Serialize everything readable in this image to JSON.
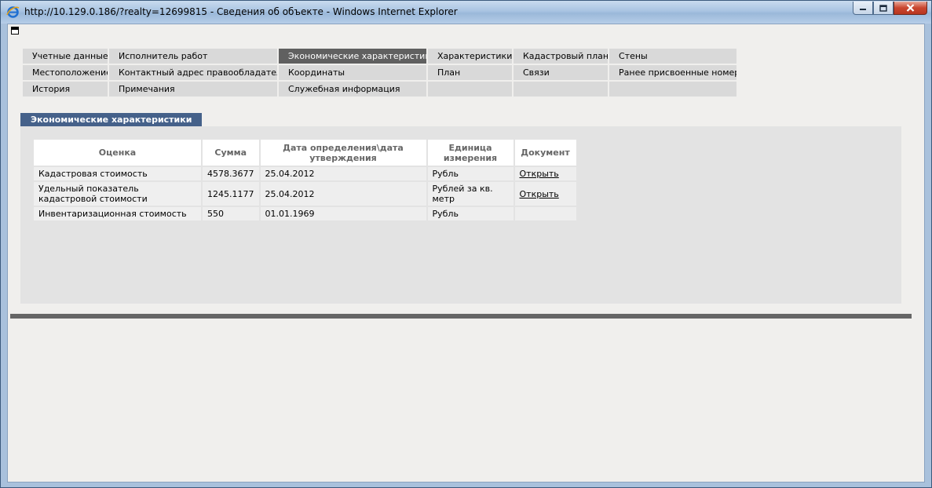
{
  "window": {
    "title": "http://10.129.0.186/?realty=12699815 - Сведения об объекте - Windows Internet Explorer",
    "icon": "ie-icon",
    "controls": [
      "minimize-icon",
      "maximize-icon",
      "close-icon"
    ]
  },
  "nav": {
    "rows": [
      [
        "Учетные данные",
        "Исполнитель работ",
        "Экономические характеристики",
        "Характеристики",
        "Кадастровый план",
        "Стены"
      ],
      [
        "Местоположение",
        "Контактный адрес правообладателя",
        "Координаты",
        "План",
        "Связи",
        "Ранее присвоенные номера"
      ],
      [
        "История",
        "Примечания",
        "Служебная информация",
        "",
        "",
        ""
      ]
    ],
    "active": "Экономические характеристики"
  },
  "section": {
    "title": "Экономические характеристики"
  },
  "table": {
    "headers": [
      "Оценка",
      "Сумма",
      "Дата определения\\дата утверждения",
      "Единица измерения",
      "Документ"
    ],
    "rows": [
      [
        "Кадастровая стоимость",
        "4578.3677",
        "25.04.2012",
        "Рубль",
        "Открыть"
      ],
      [
        "Удельный показатель кадастровой стоимости",
        "1245.1177",
        "25.04.2012",
        "Рублей за кв. метр",
        "Открыть"
      ],
      [
        "Инвентаризационная стоимость",
        "550",
        "01.01.1969",
        "Рубль",
        ""
      ]
    ]
  },
  "colors": {
    "active_tab": "#606060",
    "section_tab": "#45618a",
    "panel_bg": "#e3e3e3"
  }
}
